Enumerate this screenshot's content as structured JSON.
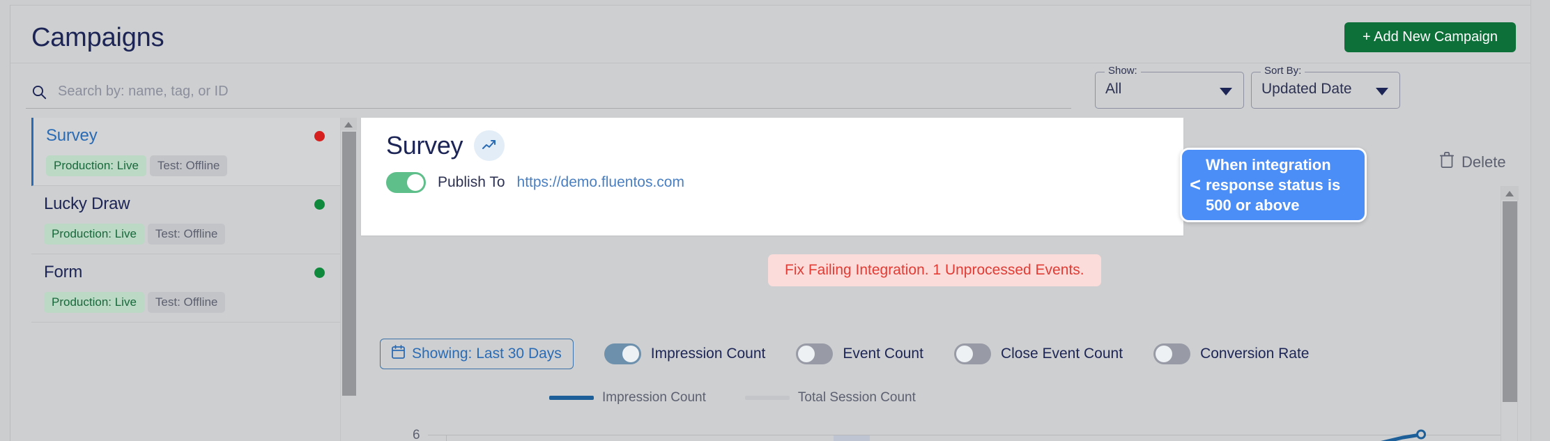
{
  "header": {
    "title": "Campaigns",
    "add_button_label": "+ Add New Campaign"
  },
  "search": {
    "placeholder": "Search by: name, tag, or ID",
    "value": "",
    "icon": "search-icon"
  },
  "filters": {
    "show": {
      "legend": "Show:",
      "value": "All"
    },
    "sort_by": {
      "legend": "Sort By:",
      "value": "Updated Date"
    }
  },
  "sidebar": {
    "items": [
      {
        "name": "Survey",
        "selected": true,
        "status_dot": "red",
        "chips": [
          {
            "label": "Production: Live",
            "kind": "prod"
          },
          {
            "label": "Test: Offline",
            "kind": "test"
          }
        ]
      },
      {
        "name": "Lucky Draw",
        "selected": false,
        "status_dot": "green",
        "chips": [
          {
            "label": "Production: Live",
            "kind": "prod"
          },
          {
            "label": "Test: Offline",
            "kind": "test"
          }
        ]
      },
      {
        "name": "Form",
        "selected": false,
        "status_dot": "green",
        "chips": [
          {
            "label": "Production: Live",
            "kind": "prod"
          },
          {
            "label": "Test: Offline",
            "kind": "test"
          }
        ]
      }
    ]
  },
  "detail": {
    "title": "Survey",
    "trend_icon": "trending-up-icon",
    "publish_toggle_on": true,
    "publish_label": "Publish To",
    "publish_url": "https://demo.fluentos.com",
    "error_message": "Fix Failing Integration. 1 Unprocessed Events.",
    "delete_label": "Delete",
    "delete_icon": "trash-icon"
  },
  "tooltip": {
    "chevron": "<",
    "text": "When integration response status is 500 or above",
    "background": "#4c8ef7"
  },
  "metrics": {
    "date_range_label": "Showing: Last 30 Days",
    "date_icon": "calendar-icon",
    "toggles": [
      {
        "label": "Impression Count",
        "on": true
      },
      {
        "label": "Event Count",
        "on": false
      },
      {
        "label": "Close Event Count",
        "on": false
      },
      {
        "label": "Conversion Rate",
        "on": false
      }
    ]
  },
  "chart_data": {
    "type": "line",
    "title": "",
    "xlabel": "",
    "ylabel": "",
    "ylim": [
      0,
      6
    ],
    "yticks": [
      6
    ],
    "ytick_labels": [
      "6"
    ],
    "grid": true,
    "legend_position": "top-center",
    "series": [
      {
        "name": "Impression Count",
        "color": "#1c5f99",
        "values": []
      },
      {
        "name": "Total Session Count",
        "color": "#c3c5c8",
        "values": []
      }
    ],
    "annotations": [
      {
        "type": "hover-band",
        "label": ""
      },
      {
        "type": "data-point-marker",
        "color": "#1c5f99"
      }
    ]
  },
  "colors": {
    "accent_green": "#0c7038",
    "accent_blue": "#2a6bb5",
    "danger": "#e23b33",
    "tooltip_blue": "#4c8ef7"
  }
}
